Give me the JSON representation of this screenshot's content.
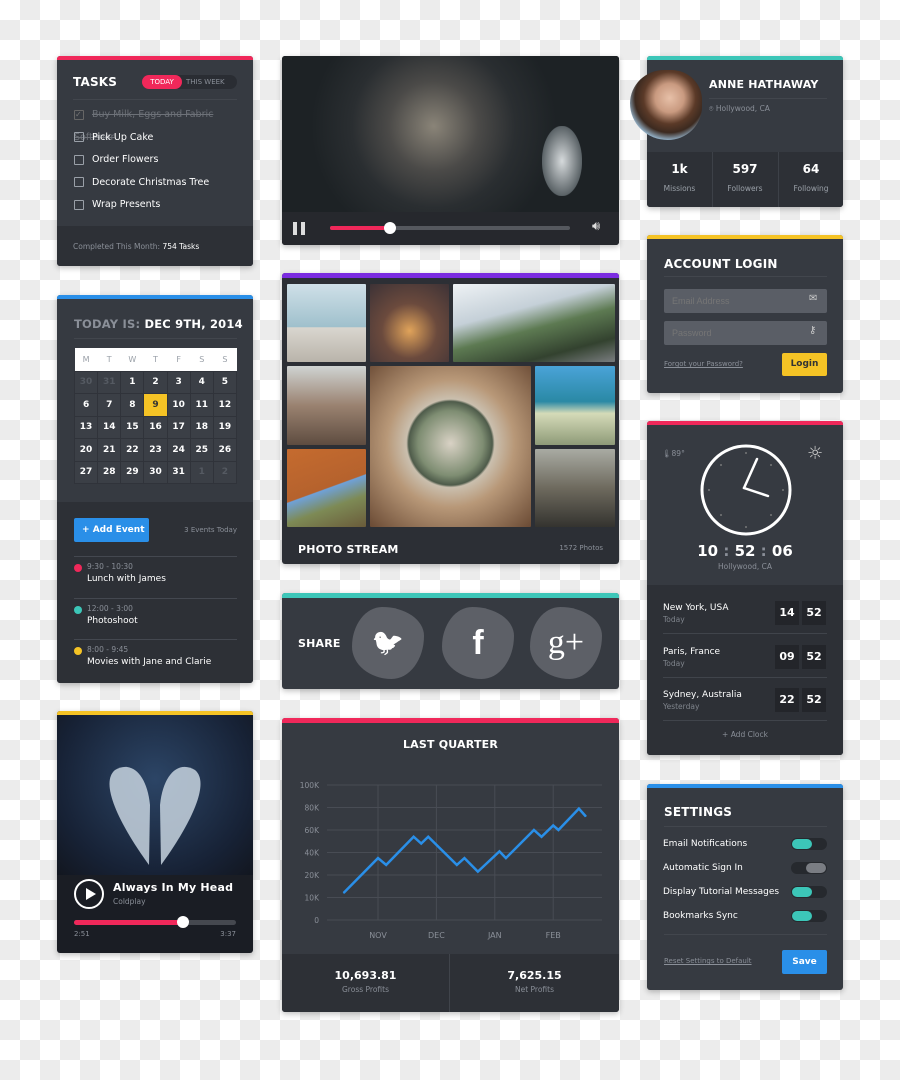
{
  "colors": {
    "pink": "#f0285a",
    "blue": "#2a8fe8",
    "yellow": "#f5c325",
    "teal": "#3cc6b8",
    "purple": "#7a2be0",
    "card": "#363a41"
  },
  "tasks": {
    "title": "TASKS",
    "tabs": [
      {
        "label": "TODAY",
        "active": true
      },
      {
        "label": "THIS WEEK",
        "active": false
      }
    ],
    "items": [
      {
        "label": "Buy Milk, Eggs and Fabric Softener",
        "done": true
      },
      {
        "label": "Pick Up Cake",
        "done": false
      },
      {
        "label": "Order Flowers",
        "done": false
      },
      {
        "label": "Decorate Christmas Tree",
        "done": false
      },
      {
        "label": "Wrap Presents",
        "done": false
      }
    ],
    "footer_label": "Completed This Month:",
    "footer_value": "754 Tasks"
  },
  "calendar": {
    "prefix": "TODAY IS:",
    "date": "DEC 9TH, 2014",
    "weekdays": [
      "M",
      "T",
      "W",
      "T",
      "F",
      "S",
      "S"
    ],
    "weeks": [
      [
        "30",
        "31",
        "1",
        "2",
        "3",
        "4",
        "5"
      ],
      [
        "6",
        "7",
        "8",
        "9",
        "10",
        "11",
        "12"
      ],
      [
        "13",
        "14",
        "15",
        "16",
        "17",
        "18",
        "19"
      ],
      [
        "20",
        "21",
        "22",
        "23",
        "24",
        "25",
        "26"
      ],
      [
        "27",
        "28",
        "29",
        "30",
        "31",
        "1",
        "2"
      ]
    ],
    "selected": "9",
    "add_event": "Add Event",
    "events_count": "3 Events Today",
    "events": [
      {
        "time": "9:30 - 10:30",
        "title": "Lunch with James",
        "color": "#f0285a"
      },
      {
        "time": "12:00 - 3:00",
        "title": "Photoshoot",
        "color": "#3cc6b8"
      },
      {
        "time": "8:00 - 9:45",
        "title": "Movies with Jane and Clarie",
        "color": "#f5c325"
      }
    ]
  },
  "music": {
    "title": "Always In My Head",
    "artist": "Coldplay",
    "elapsed": "2:51",
    "total": "3:37",
    "progress": 0.67
  },
  "video": {
    "progress": 0.25,
    "state": "playing"
  },
  "photo_stream": {
    "title": "PHOTO STREAM",
    "count": "1572 Photos"
  },
  "share": {
    "label": "SHARE",
    "networks": [
      {
        "name": "twitter",
        "glyph": "🐦"
      },
      {
        "name": "facebook",
        "glyph": "f"
      },
      {
        "name": "google-plus",
        "glyph": "g+"
      }
    ]
  },
  "chart_data": {
    "type": "line",
    "title": "LAST QUARTER",
    "categories": [
      "NOV",
      "DEC",
      "JAN",
      "FEB"
    ],
    "yticks": [
      "0",
      "10K",
      "20K",
      "40K",
      "60K",
      "80K",
      "100K"
    ],
    "ytick_values": [
      0,
      10000,
      20000,
      40000,
      60000,
      80000,
      100000
    ],
    "ylim": [
      0,
      100000
    ],
    "grid": true,
    "series": [
      {
        "x": [
          -0.59,
          0,
          0.14,
          0.61,
          0.74,
          0.86,
          1.35,
          1.48,
          1.71,
          2.08,
          2.19,
          2.67,
          2.8,
          3,
          3.09,
          3.44,
          3.56
        ],
        "y": [
          12000,
          35000,
          29000,
          54000,
          48000,
          54000,
          29000,
          35000,
          23000,
          41000,
          35000,
          60000,
          54000,
          64000,
          60000,
          79000,
          72000
        ],
        "color": "#2a8fe8"
      }
    ],
    "summary": [
      {
        "value": "10,693.81",
        "label": "Gross Profits"
      },
      {
        "value": "7,625.15",
        "label": "Net Profits"
      }
    ]
  },
  "profile": {
    "name": "ANNE HATHAWAY",
    "location": "Hollywood, CA",
    "stats": [
      {
        "value": "1k",
        "label": "Missions"
      },
      {
        "value": "597",
        "label": "Followers"
      },
      {
        "value": "64",
        "label": "Following"
      }
    ]
  },
  "login": {
    "title": "ACCOUNT LOGIN",
    "email_placeholder": "Email Address",
    "password_placeholder": "Password",
    "forgot": "Forgot your Password?",
    "button": "Login"
  },
  "clock": {
    "temperature": "89°",
    "hh": "10",
    "mm": "52",
    "ss": "06",
    "location": "Hollywood, CA",
    "cities": [
      {
        "city": "New York, USA",
        "day": "Today",
        "h": "14",
        "m": "52"
      },
      {
        "city": "Paris, France",
        "day": "Today",
        "h": "09",
        "m": "52"
      },
      {
        "city": "Sydney, Australia",
        "day": "Yesterday",
        "h": "22",
        "m": "52"
      }
    ],
    "add": "Add Clock"
  },
  "settings": {
    "title": "SETTINGS",
    "items": [
      {
        "label": "Email Notifications",
        "on": true
      },
      {
        "label": "Automatic Sign In",
        "on": false
      },
      {
        "label": "Display Tutorial Messages",
        "on": true
      },
      {
        "label": "Bookmarks Sync",
        "on": true
      }
    ],
    "reset": "Reset Settings to Default",
    "save": "Save"
  }
}
